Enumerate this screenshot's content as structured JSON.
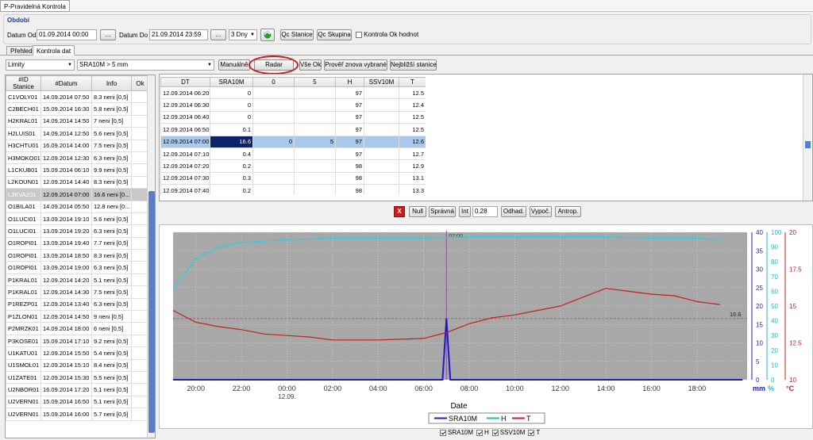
{
  "window": {
    "title": "P-Pravidelná Kontrola"
  },
  "period": {
    "group_title": "Období",
    "date_from_label": "Datum Od",
    "date_from_value": "01.09.2014 00:00",
    "date_to_label": "Datum Do",
    "date_to_value": "21.09.2014 23:59",
    "browse_label": "...",
    "span_value": "3 Dny",
    "qc_station_label": "Qc Stanice",
    "qc_group_label": "Qc Skupina",
    "ok_check_label": "Kontrola Ok hodnot"
  },
  "tabs": [
    {
      "label": "Přehled"
    },
    {
      "label": "Kontrola dat"
    }
  ],
  "toolbar": {
    "limits_value": "Limity",
    "filter_value": "SRA10M > 5 mm",
    "manual_label": "Manuálně",
    "radar_label": "Radar",
    "all_ok_label": "Vše Ok",
    "recheck_label": "Prověř znova vybrané",
    "nearest_label": "Nejbližší stanice"
  },
  "left_table": {
    "headers": [
      "#ID Stanice",
      "#Datum",
      "Info",
      "Ok"
    ],
    "rows": [
      [
        "C1VOLY01",
        "14.09.2014 07:50",
        "8.3 neni [0,5]",
        ""
      ],
      [
        "C2BECH01",
        "15.09.2014 16:30",
        "5.8 neni [0,5]",
        ""
      ],
      [
        "H2KRAL01",
        "14.09.2014 14:50",
        "7 neni [0,5]",
        ""
      ],
      [
        "H2LUIS01",
        "14.09.2014 12:50",
        "5.6 neni [0,5]",
        ""
      ],
      [
        "H3CHTU01",
        "16.09.2014 14:00",
        "7.5 neni [0,5]",
        ""
      ],
      [
        "H3MOKO01",
        "12.09.2014 12:30",
        "6.3 neni [0,5]",
        ""
      ],
      [
        "L1CKUB01",
        "15.09.2014 06:10",
        "9.9 neni [0,5]",
        ""
      ],
      [
        "L2KOUN01",
        "12.09.2014 14:40",
        "8.3 neni [0,5]",
        ""
      ],
      [
        "L3KVAZ01",
        "12.09.2014 07:00",
        "16.6 neni [0...",
        ""
      ],
      [
        "O1BILA01",
        "14.09.2014 05:50",
        "12.8 neni [0...",
        ""
      ],
      [
        "O1LUCI01",
        "13.09.2014 19:10",
        "5.6 neni [0,5]",
        ""
      ],
      [
        "O1LUCI01",
        "13.09.2014 19:20",
        "6.3 neni [0,5]",
        ""
      ],
      [
        "O1ROPI01",
        "13.09.2014 19:40",
        "7.7 neni [0,5]",
        ""
      ],
      [
        "O1ROPI01",
        "13.09.2014 18:50",
        "8.3 neni [0,5]",
        ""
      ],
      [
        "O1ROPI01",
        "13.09.2014 19:00",
        "6.3 neni [0,5]",
        ""
      ],
      [
        "P1KRAL01",
        "12.09.2014 14:20",
        "5.1 neni [0,5]",
        ""
      ],
      [
        "P1KRAL01",
        "12.09.2014 14:30",
        "7.5 neni [0,5]",
        ""
      ],
      [
        "P1REZP01",
        "12.09.2014 13:40",
        "6.3 neni [0,5]",
        ""
      ],
      [
        "P1ZLON01",
        "12.09.2014 14:50",
        "9 neni [0,5]",
        ""
      ],
      [
        "P2MRZK01",
        "14.09.2014 18:00",
        "6 neni [0,5]",
        ""
      ],
      [
        "P3KOSE01",
        "15.09.2014 17:10",
        "9.2 neni [0,5]",
        ""
      ],
      [
        "U1KATU01",
        "12.09.2014 15:50",
        "5.4 neni [0,5]",
        ""
      ],
      [
        "U1SMOL01",
        "12.09.2014 15:10",
        "8.4 neni [0,5]",
        ""
      ],
      [
        "U1ZATE01",
        "12.09.2014 15:30",
        "5.5 neni [0,5]",
        ""
      ],
      [
        "U2NBOR01",
        "16.09.2014 17:20",
        "5.1 neni [0,5]",
        ""
      ],
      [
        "U2VERN01",
        "15.09.2014 16:50",
        "5.1 neni [0,5]",
        ""
      ],
      [
        "U2VERN01",
        "15.09.2014 16:00",
        "5.7 neni [0,5]",
        ""
      ]
    ]
  },
  "right_table": {
    "headers": [
      "DT",
      "SRA10M",
      "0",
      "5",
      "H",
      "SSV10M",
      "T"
    ],
    "rows": [
      [
        "12.09.2014 06:20",
        "0",
        "",
        "",
        "97",
        "",
        "12.5"
      ],
      [
        "12.09.2014 06:30",
        "0",
        "",
        "",
        "97",
        "",
        "12.4"
      ],
      [
        "12.09.2014 06:40",
        "0",
        "",
        "",
        "97",
        "",
        "12.5"
      ],
      [
        "12.09.2014 06:50",
        "0.1",
        "",
        "",
        "97",
        "",
        "12.5"
      ],
      [
        "12.09.2014 07:00",
        "16.6",
        "0",
        "5",
        "97",
        "",
        "12.6"
      ],
      [
        "12.09.2014 07:10",
        "0.4",
        "",
        "",
        "97",
        "",
        "12.7"
      ],
      [
        "12.09.2014 07:20",
        "0.2",
        "",
        "",
        "98",
        "",
        "12.9"
      ],
      [
        "12.09.2014 07:30",
        "0.3",
        "",
        "",
        "98",
        "",
        "13.1"
      ],
      [
        "12.09.2014 07:40",
        "0.2",
        "",
        "",
        "98",
        "",
        "13.3"
      ],
      [
        "12.09.2014 07:50",
        "0.2",
        "",
        "",
        "98",
        "",
        "13.7"
      ]
    ]
  },
  "edit_bar": {
    "x_label": "X",
    "null_label": "Null",
    "correct_label": "Správná",
    "int_label": "Int",
    "int_value": "0.28",
    "estimate_label": "Odhad.",
    "compute_label": "Vypoč.",
    "antrop_label": "Antrop."
  },
  "chart_data": {
    "type": "line",
    "xlabel": "Date",
    "x_ticks": [
      "20:00",
      "22:00",
      "00:00",
      "02:00",
      "04:00",
      "06:00",
      "08:00",
      "10:00",
      "12:00",
      "14:00",
      "16:00",
      "18:00"
    ],
    "x_date_label": "12.09.",
    "marker_label": "07:00",
    "ref_label": "16.6",
    "axes": [
      {
        "unit": "mm",
        "range": [
          0,
          40
        ],
        "ticks": [
          "0",
          "5",
          "10",
          "15",
          "20",
          "25",
          "30",
          "35",
          "40"
        ],
        "color": "#1c1cbf"
      },
      {
        "unit": "%",
        "range": [
          0,
          100
        ],
        "ticks": [
          "0",
          "10",
          "20",
          "30",
          "40",
          "50",
          "60",
          "70",
          "80",
          "90",
          "100"
        ],
        "color": "#20b8c8"
      },
      {
        "unit": "°C",
        "range": [
          10,
          20
        ],
        "ticks": [
          "10",
          "12.5",
          "15",
          "17.5",
          "20"
        ],
        "color": "#c02020"
      }
    ],
    "legend": [
      {
        "name": "SRA10M",
        "color": "#1c1cbf"
      },
      {
        "name": "H",
        "color": "#20b8c8"
      },
      {
        "name": "T",
        "color": "#c02020"
      }
    ],
    "series_toggles": [
      {
        "name": "SRA10M",
        "checked": true
      },
      {
        "name": "H",
        "checked": true
      },
      {
        "name": "SSV10M",
        "checked": true
      },
      {
        "name": "T",
        "checked": true
      }
    ],
    "series": [
      {
        "name": "SRA10M",
        "hours": [
          -5,
          6.83,
          7,
          7.17,
          20
        ],
        "values": [
          0,
          0,
          16.6,
          0,
          0
        ]
      },
      {
        "name": "H",
        "hours": [
          -5,
          -4.5,
          -4,
          -3,
          -2,
          0,
          2,
          4,
          6,
          8,
          10,
          12,
          14,
          16,
          18,
          19
        ],
        "values": [
          62,
          72,
          82,
          90,
          93,
          95,
          96,
          96,
          96,
          97,
          97,
          97,
          97,
          96,
          96,
          95
        ]
      },
      {
        "name": "T",
        "hours": [
          -5,
          -4.5,
          -4,
          -3,
          -2,
          -1,
          0,
          1,
          2,
          4,
          6,
          6.5,
          7,
          7.5,
          8,
          9,
          10,
          11,
          12,
          13,
          14,
          15,
          16,
          17,
          18,
          19
        ],
        "values": [
          14.7,
          14.3,
          13.9,
          13.6,
          13.4,
          13.1,
          13.0,
          12.9,
          12.7,
          12.7,
          12.8,
          13.0,
          13.2,
          13.5,
          13.8,
          14.2,
          14.4,
          14.7,
          15.0,
          15.6,
          16.2,
          16.0,
          15.8,
          15.7,
          15.3,
          15.1
        ]
      }
    ]
  }
}
